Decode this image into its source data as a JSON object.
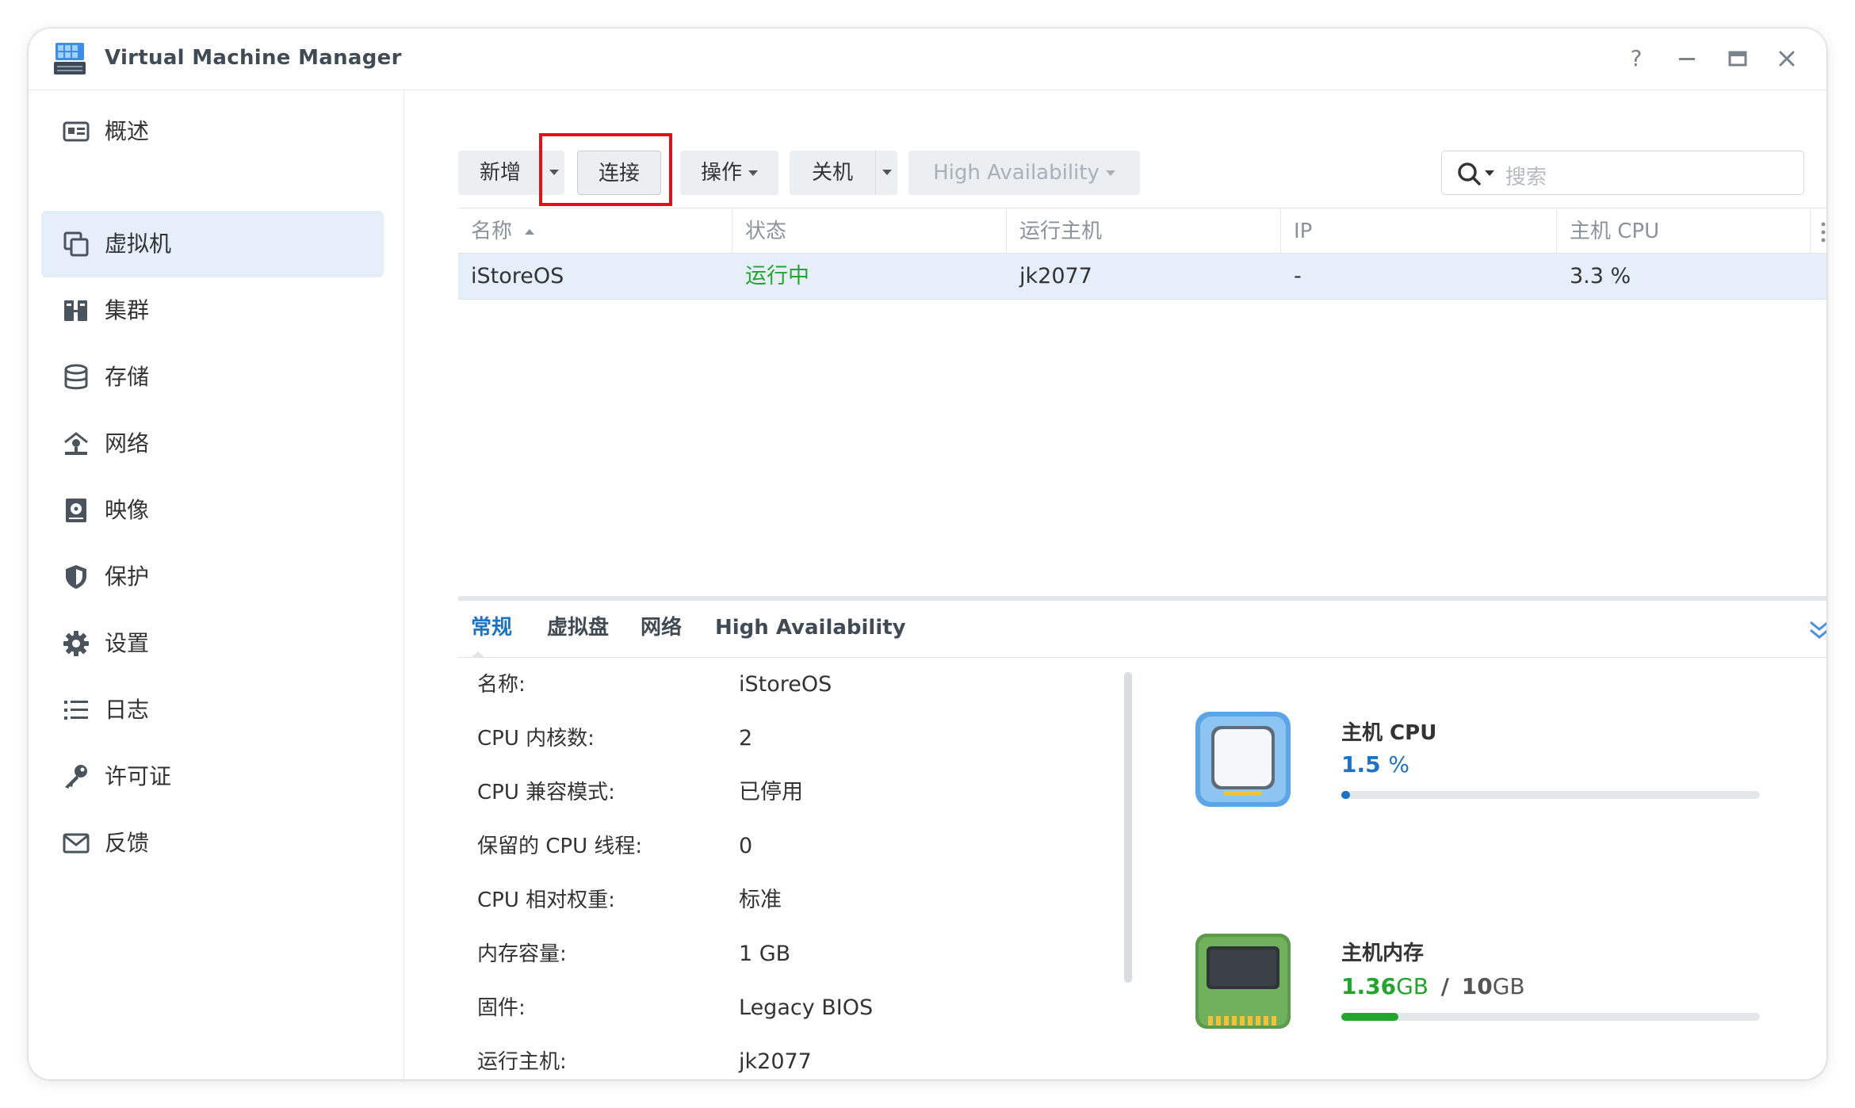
{
  "window": {
    "title": "Virtual Machine Manager"
  },
  "window_controls": {
    "help": "?",
    "minimize": "—",
    "maximize": "▭",
    "close": "✕"
  },
  "sidebar": {
    "items": [
      {
        "label": "概述",
        "icon": "overview-icon"
      },
      {
        "label": "虚拟机",
        "icon": "virtual-machine-icon",
        "active": true
      },
      {
        "label": "集群",
        "icon": "cluster-icon"
      },
      {
        "label": "存储",
        "icon": "storage-icon"
      },
      {
        "label": "网络",
        "icon": "network-icon"
      },
      {
        "label": "映像",
        "icon": "image-icon"
      },
      {
        "label": "保护",
        "icon": "shield-icon"
      },
      {
        "label": "设置",
        "icon": "gear-icon"
      },
      {
        "label": "日志",
        "icon": "log-list-icon"
      },
      {
        "label": "许可证",
        "icon": "key-icon"
      },
      {
        "label": "反馈",
        "icon": "mail-icon"
      }
    ]
  },
  "toolbar": {
    "create_label": "新增",
    "connect_label": "连接",
    "action_label": "操作",
    "shutdown_label": "关机",
    "ha_label": "High Availability",
    "search_placeholder": "搜索"
  },
  "table": {
    "columns": [
      "名称",
      "状态",
      "运行主机",
      "IP",
      "主机 CPU"
    ],
    "rows": [
      {
        "name": "iStoreOS",
        "status": "运行中",
        "host": "jk2077",
        "ip": "-",
        "cpu": "3.3 %"
      }
    ]
  },
  "detail_tabs": [
    "常规",
    "虚拟盘",
    "网络",
    "High Availability"
  ],
  "properties": [
    {
      "label": "名称:",
      "value": "iStoreOS"
    },
    {
      "label": "CPU 内核数:",
      "value": "2"
    },
    {
      "label": "CPU 兼容模式:",
      "value": "已停用"
    },
    {
      "label": "保留的 CPU 线程:",
      "value": "0"
    },
    {
      "label": "CPU 相对权重:",
      "value": "标准"
    },
    {
      "label": "内存容量:",
      "value": "1 GB"
    },
    {
      "label": "固件:",
      "value": "Legacy BIOS"
    },
    {
      "label": "运行主机:",
      "value": "jk2077"
    }
  ],
  "resources": {
    "cpu": {
      "title": "主机 CPU",
      "value": "1.5",
      "unit": "%",
      "percent": 1.5,
      "color": "#1a73c9"
    },
    "memory": {
      "title": "主机内存",
      "used": "1.36",
      "used_unit": "GB",
      "separator": "/",
      "total": "10",
      "total_unit": "GB",
      "percent": 13.6,
      "color": "#22a52c"
    }
  }
}
